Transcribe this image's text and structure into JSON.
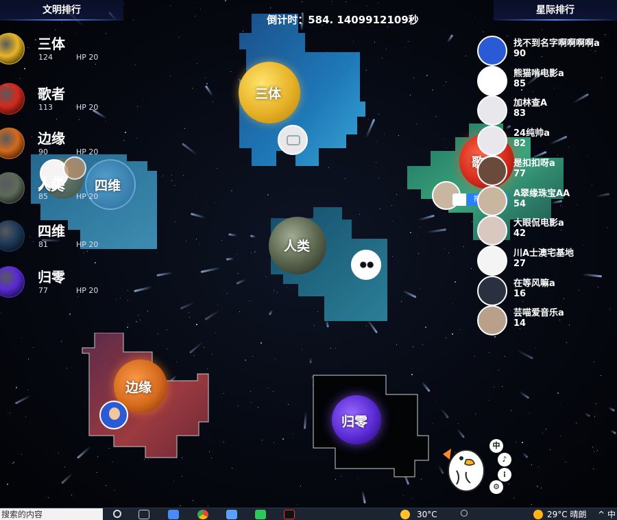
{
  "header": {
    "civ_ranking_title": "文明排行",
    "star_ranking_title": "星际排行",
    "countdown_label": "倒计时：",
    "countdown_value": "584. 1409912109秒"
  },
  "civilizations": [
    {
      "name": "三体",
      "score": "124",
      "hp": "HP 20",
      "color": "#e8b525"
    },
    {
      "name": "歌者",
      "score": "113",
      "hp": "HP 20",
      "color": "#d42a1c"
    },
    {
      "name": "边缘",
      "score": "90",
      "hp": "HP 20",
      "color": "#d46a1c"
    },
    {
      "name": "人类",
      "score": "85",
      "hp": "HP 20",
      "color": "#5d6b5a"
    },
    {
      "name": "四维",
      "score": "81",
      "hp": "HP 20",
      "color": "#1e3a5a"
    },
    {
      "name": "归零",
      "score": "77",
      "hp": "HP 20",
      "color": "#5a2ad4"
    }
  ],
  "map_labels": {
    "santi": "三体",
    "siwei": "四维",
    "renlei_small": "人类",
    "renlei": "人类",
    "biany": "边缘",
    "guiling": "归零",
    "gezhe": "歌"
  },
  "star_ranking": [
    {
      "name": "找不到名字啊啊啊啊a",
      "score": "90",
      "avatar": "kid"
    },
    {
      "name": "熊猫啃电影a",
      "score": "85",
      "avatar": "panda"
    },
    {
      "name": "加林查A",
      "score": "83",
      "avatar": "tv"
    },
    {
      "name": "24纯帅a",
      "score": "82",
      "avatar": "tv"
    },
    {
      "name": "是扣扣呀a",
      "score": "77",
      "avatar": "group"
    },
    {
      "name": "A翠缘珠宝AA",
      "score": "54",
      "avatar": "cat"
    },
    {
      "name": "大眼侃电影a",
      "score": "42",
      "avatar": "girl"
    },
    {
      "name": "川A士澳宅基地",
      "score": "27",
      "avatar": "dog"
    },
    {
      "name": "在等风嘛a",
      "score": "16",
      "avatar": "anime"
    },
    {
      "name": "芸喵爱音乐a",
      "score": "14",
      "avatar": "cat2"
    }
  ],
  "upload_chip": "拖拽上传",
  "side_buttons": [
    "中",
    "♪",
    "⁝",
    "⚙"
  ],
  "taskbar": {
    "search_text": "搜索的内容",
    "weather_left": "30°C",
    "weather_right": "29°C  晴朗",
    "ime": "中"
  },
  "colors": {
    "santi_territory": "#1e6fae",
    "siwei_territory": "#2a6f9a",
    "renlei_territory": "#1f6b86",
    "biany_territory": "#8a3040",
    "guiling_territory": "#040608",
    "gezhe_territory": "#2f8f78"
  }
}
